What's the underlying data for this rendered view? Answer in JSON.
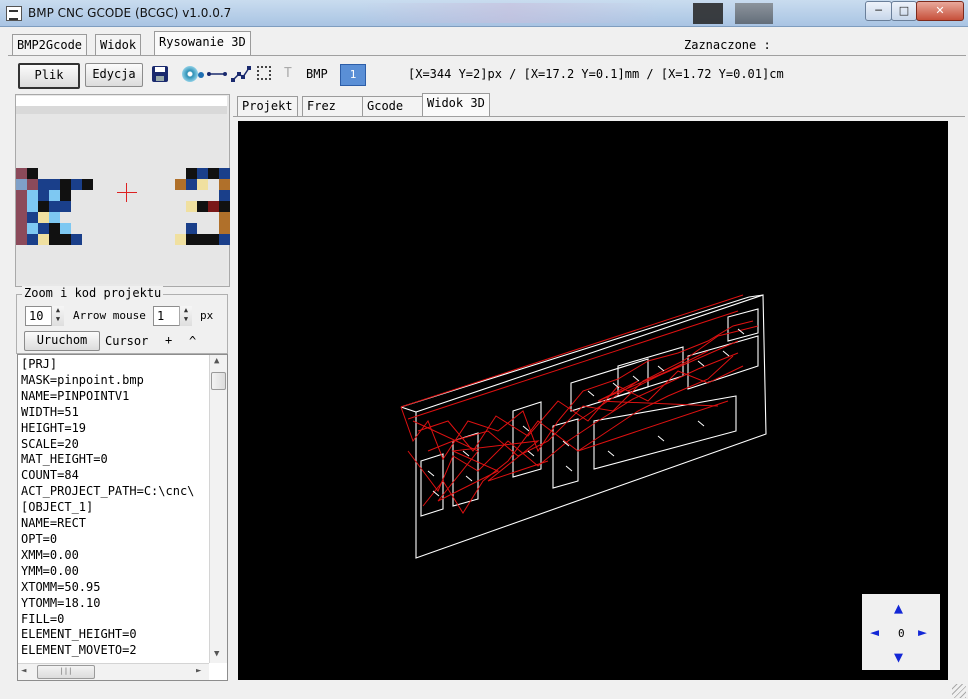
{
  "window": {
    "title": "BMP CNC GCODE (BCGC) v1.0.0.7",
    "minimize": "─",
    "maximize": "□",
    "close": "✕"
  },
  "main_tabs": [
    "BMP2Gcode",
    "Widok",
    "Rysowanie 3D"
  ],
  "zaznaczone_label": "Zaznaczone :",
  "toolbar": {
    "plik": "Plik",
    "edycja": "Edycja",
    "text_tool": "T",
    "bmp": "BMP",
    "ruler": "1",
    "coords": "[X=344 Y=2]px / [X=17.2 Y=0.1]mm / [X=1.72 Y=0.01]cm",
    "icons": [
      "save-icon",
      "disc-icon",
      "line-icon",
      "polyline-icon",
      "rectangle-icon",
      "text-icon",
      "ruler-icon"
    ]
  },
  "zoom_panel": {
    "legend": "Zoom i kod projektu",
    "zoom_value": "10",
    "arrow_mouse_label": "Arrow mouse",
    "arrow_mouse_value": "1",
    "px_label": "px",
    "run_button": "Uruchom",
    "cursor_label": "Cursor",
    "cursor_plus": "+",
    "cursor_caret": "^"
  },
  "project_code": [
    "[PRJ]",
    "MASK=pinpoint.bmp",
    "NAME=PINPOINTV1",
    "WIDTH=51",
    "HEIGHT=19",
    "SCALE=20",
    "MAT_HEIGHT=0",
    "COUNT=84",
    "ACT_PROJECT_PATH=C:\\cnc\\",
    "[OBJECT_1]",
    "NAME=RECT",
    "OPT=0",
    "XMM=0.00",
    "YMM=0.00",
    "XTOMM=50.95",
    "YTOMM=18.10",
    "FILL=0",
    "ELEMENT_HEIGHT=0",
    "ELEMENT_MOVETO=2"
  ],
  "sub_tabs": [
    "Projekt",
    "Frez",
    "Gcode",
    "Widok 3D"
  ],
  "navigator": {
    "zero": "0",
    "up": "▲",
    "down": "▼",
    "left": "◄",
    "right": "►"
  },
  "colors": {
    "viewport_bg": "#000000",
    "outline": "#ffffff",
    "toolpath": "#dd1111",
    "nav_arrow": "#1327d6",
    "crosshair": "#dd2222"
  }
}
